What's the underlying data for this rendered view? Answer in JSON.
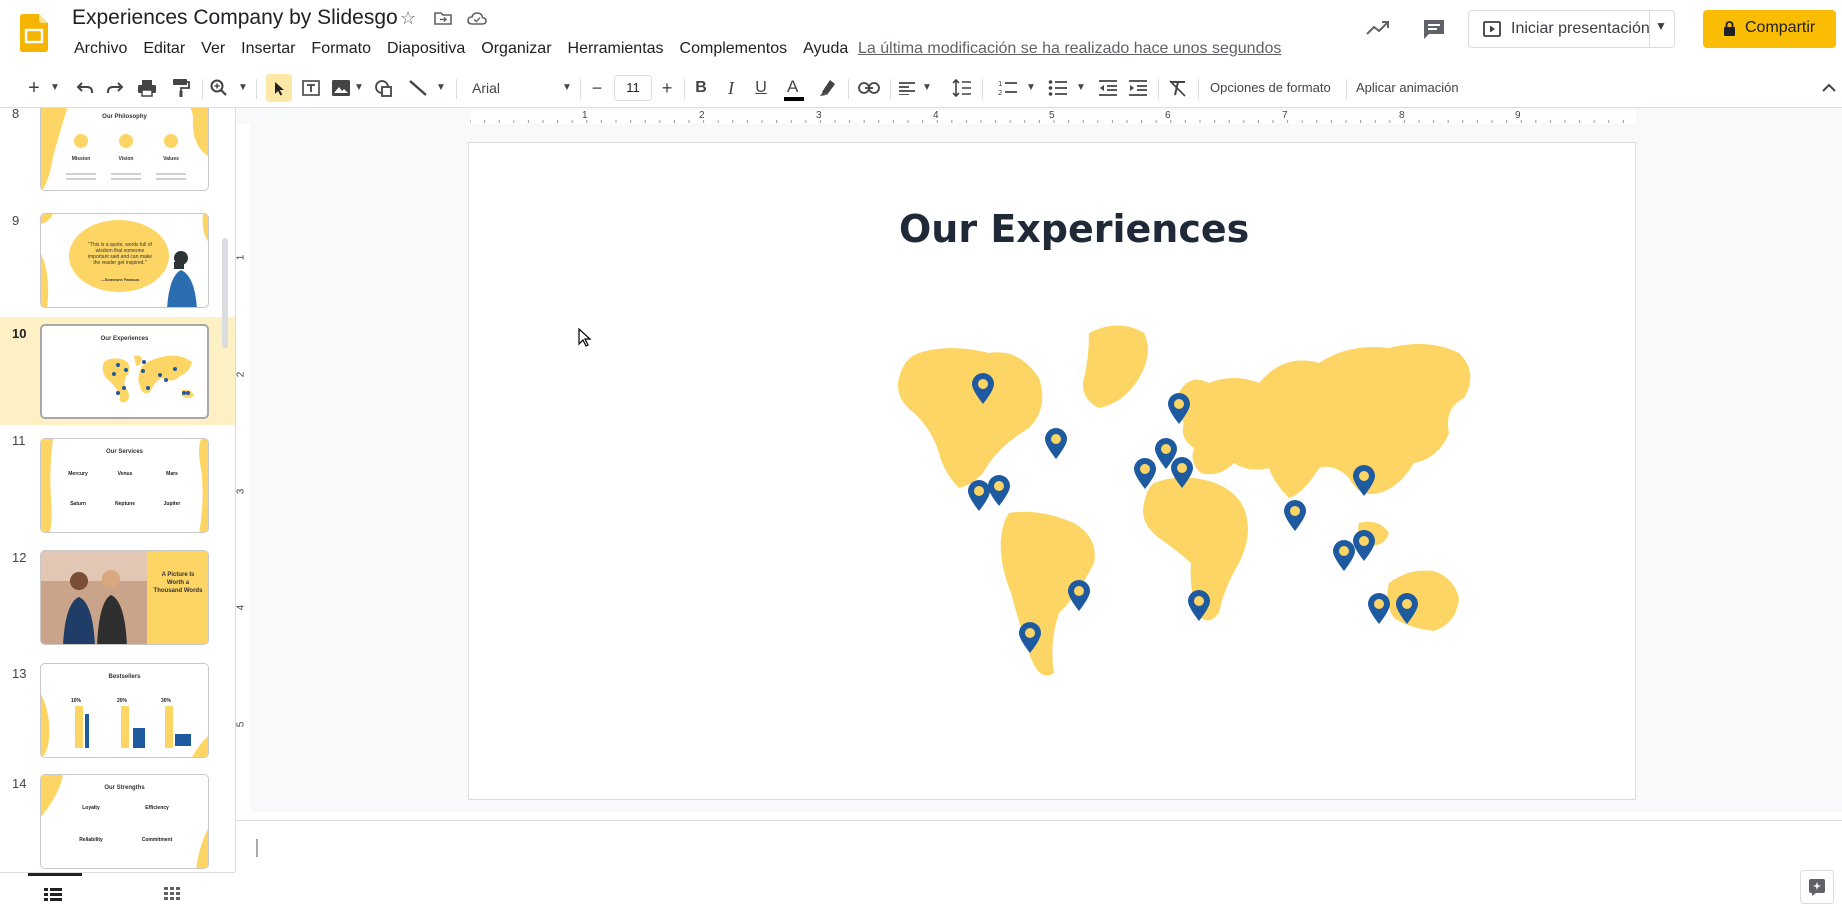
{
  "header": {
    "doc_title": "Experiences Company by Slidesgo",
    "menu": [
      "Archivo",
      "Editar",
      "Ver",
      "Insertar",
      "Formato",
      "Diapositiva",
      "Organizar",
      "Herramientas",
      "Complementos",
      "Ayuda"
    ],
    "last_modified": "La última modificación se ha realizado hace unos segundos",
    "present_label": "Iniciar presentación",
    "share_label": "Compartir"
  },
  "toolbar": {
    "font_name": "Arial",
    "font_size": "11",
    "format_options": "Opciones de formato",
    "apply_animation": "Aplicar animación"
  },
  "ruler": {
    "top": [
      "1",
      "2",
      "3",
      "4",
      "5",
      "6",
      "7",
      "8",
      "9"
    ],
    "left": [
      "1",
      "2",
      "3",
      "4",
      "5"
    ]
  },
  "filmstrip": {
    "slides": [
      {
        "num": "8",
        "title": "Our Philosophy",
        "labels": [
          "Mission",
          "Vision",
          "Values"
        ]
      },
      {
        "num": "9",
        "title": "",
        "quote": "\"This is a quote, words full of wisdom that someone important said and can make the reader get inspired.\"",
        "author": "—Someone Famous"
      },
      {
        "num": "10",
        "title": "Our Experiences"
      },
      {
        "num": "11",
        "title": "Our Services",
        "labels": [
          "Mercury",
          "Venus",
          "Mars",
          "Saturn",
          "Neptune",
          "Jupiter"
        ]
      },
      {
        "num": "12",
        "title": "A Picture Is Worth a Thousand Words"
      },
      {
        "num": "13",
        "title": "Bestsellers",
        "labels": [
          "10%",
          "20%",
          "30%"
        ]
      },
      {
        "num": "14",
        "title": "Our Strengths",
        "labels": [
          "Loyalty",
          "Efficiency",
          "Reliability",
          "Commitment"
        ]
      }
    ]
  },
  "slide": {
    "title": "Our Experiences",
    "map_color": "#fdd565",
    "pin_color": "#1e5aa0"
  },
  "colors": {
    "accent_yellow": "#fbbc04",
    "selected_slide_bg": "#fdf0c4",
    "thumb_yellow": "#fdd565"
  }
}
